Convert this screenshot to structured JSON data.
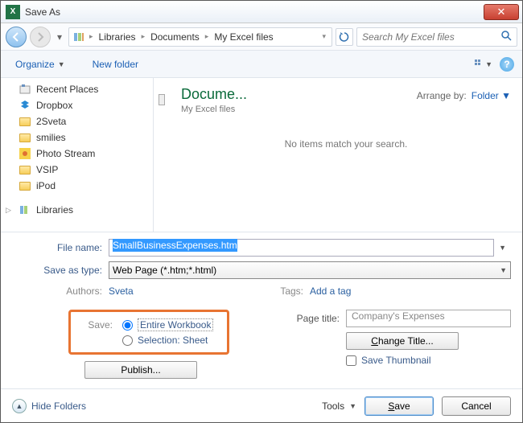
{
  "window": {
    "title": "Save As"
  },
  "breadcrumb": {
    "root": "Libraries",
    "mid": "Documents",
    "leaf": "My Excel files"
  },
  "search": {
    "placeholder": "Search My Excel files"
  },
  "toolbar": {
    "organize": "Organize",
    "new_folder": "New folder"
  },
  "tree": {
    "items": [
      "Recent Places",
      "Dropbox",
      "2Sveta",
      "smilies",
      "Photo Stream",
      "VSIP",
      "iPod"
    ],
    "libraries": "Libraries"
  },
  "content": {
    "title": "Docume...",
    "subtitle": "My Excel files",
    "arrange_label": "Arrange by:",
    "arrange_value": "Folder",
    "empty": "No items match your search."
  },
  "form": {
    "file_name_label": "File name:",
    "file_name_value": "SmallBusinessExpenses.htm",
    "save_as_type_label": "Save as type:",
    "save_as_type_value": "Web Page (*.htm;*.html)",
    "authors_label": "Authors:",
    "authors_value": "Sveta",
    "tags_label": "Tags:",
    "tags_value": "Add a tag",
    "save_label": "Save:",
    "radio_entire": "Entire Workbook",
    "radio_selection": "Selection: Sheet",
    "publish": "Publish...",
    "page_title_label": "Page title:",
    "page_title_value": "Company's Expenses",
    "change_title": "Change Title...",
    "save_thumbnail": "Save Thumbnail"
  },
  "footer": {
    "hide_folders": "Hide Folders",
    "tools": "Tools",
    "save": "Save",
    "cancel": "Cancel"
  }
}
